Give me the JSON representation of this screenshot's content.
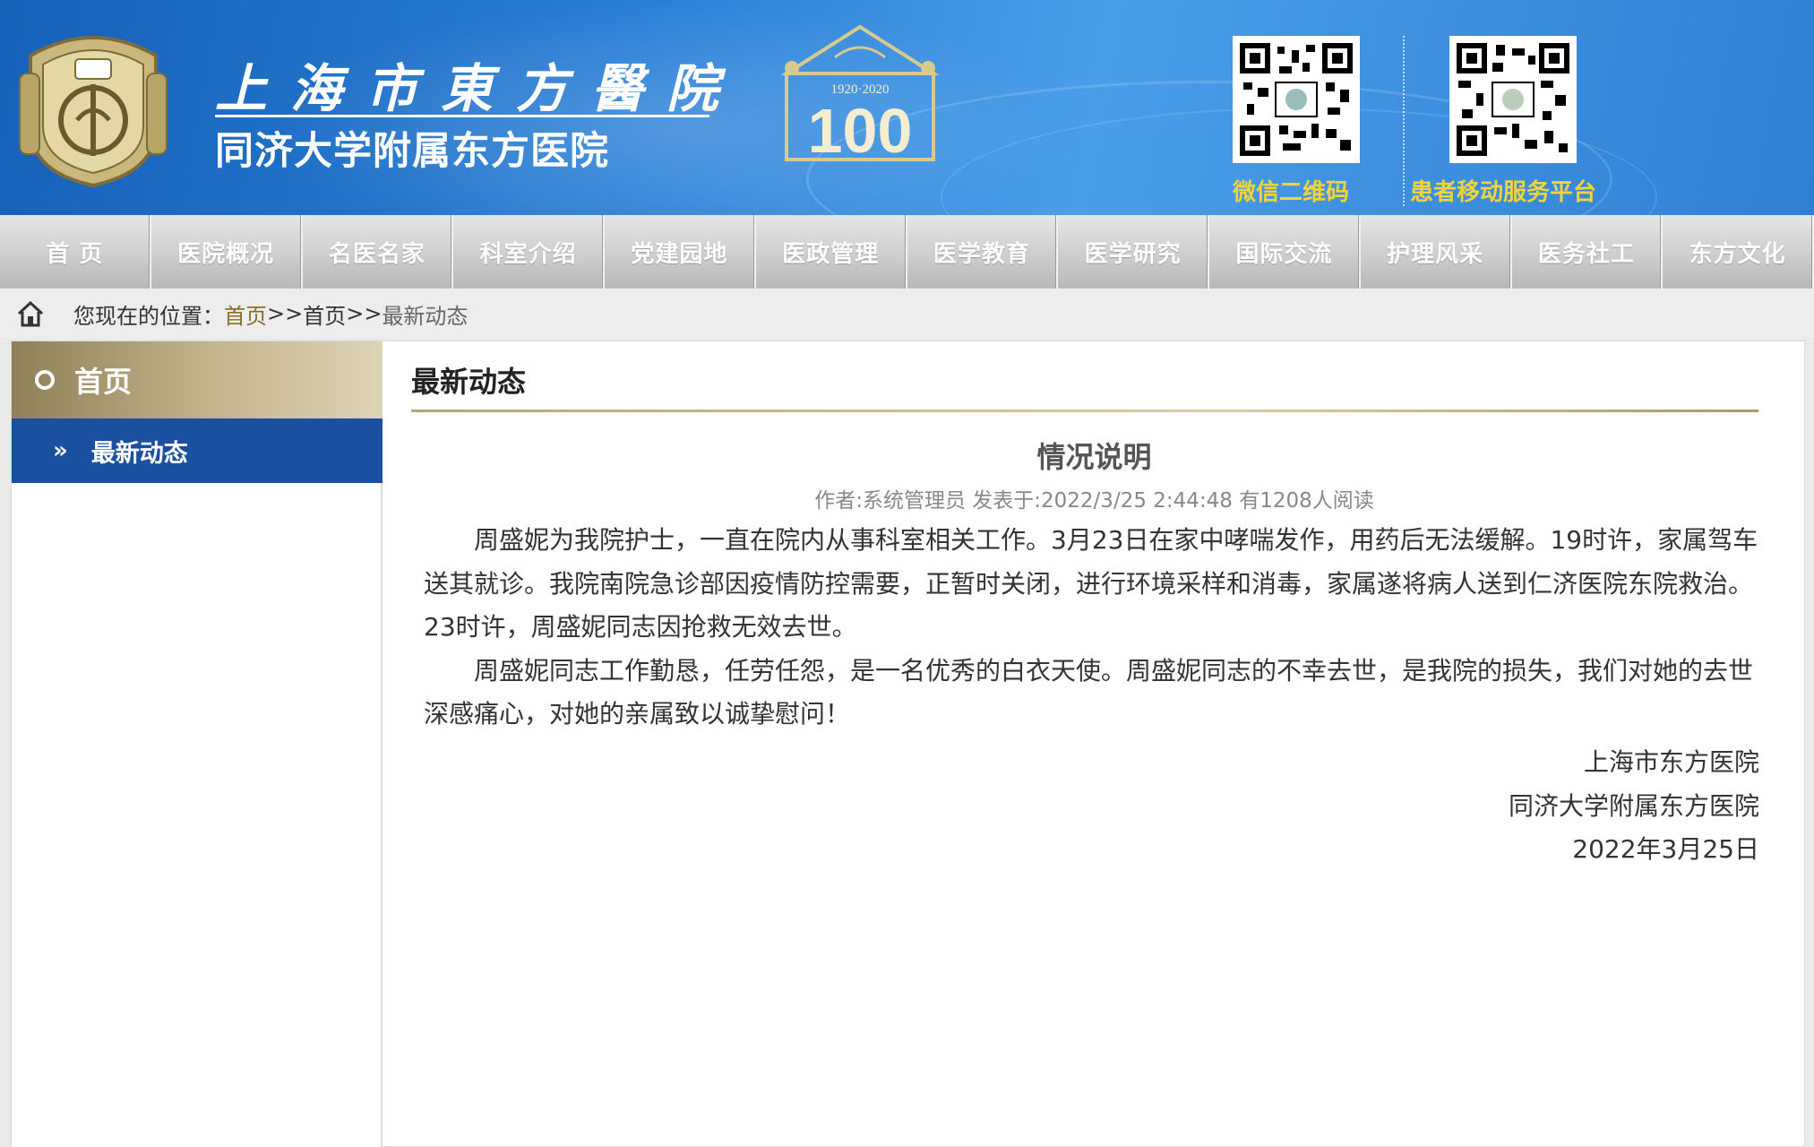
{
  "header": {
    "hospital_name": "上海市東方醫院",
    "hospital_name_sub": "同济大学附属东方医院",
    "centennial_years": "1920·2020",
    "centennial_number": "100",
    "qr_codes": [
      {
        "caption": "微信二维码"
      },
      {
        "caption": "患者移动服务平台"
      }
    ],
    "colors": {
      "header_blue": "#2a7fd6",
      "caption_yellow": "#f2d33a",
      "gold": "#c4b58c",
      "sidebar_blue": "#1b4fa0"
    }
  },
  "nav": {
    "items": [
      "首 页",
      "医院概况",
      "名医名家",
      "科室介绍",
      "党建园地",
      "医政管理",
      "医学教育",
      "医学研究",
      "国际交流",
      "护理风采",
      "医务社工",
      "东方文化"
    ]
  },
  "breadcrumb": {
    "label": "您现在的位置：",
    "link1": "首页",
    "sep1": " >>",
    "link2": "首页",
    "sep2": ">>",
    "current": "最新动态"
  },
  "sidebar": {
    "heading": "首页",
    "items": [
      {
        "label": "最新动态"
      }
    ]
  },
  "main": {
    "section_title": "最新动态",
    "article": {
      "title": "情况说明",
      "meta": "作者:系统管理员 发表于:2022/3/25 2:44:48 有1208人阅读",
      "paragraphs": [
        "周盛妮为我院护士，一直在院内从事科室相关工作。3月23日在家中哮喘发作，用药后无法缓解。19时许，家属驾车送其就诊。我院南院急诊部因疫情防控需要，正暂时关闭，进行环境采样和消毒，家属遂将病人送到仁济医院东院救治。23时许，周盛妮同志因抢救无效去世。",
        "周盛妮同志工作勤恳，任劳任怨，是一名优秀的白衣天使。周盛妮同志的不幸去世，是我院的损失，我们对她的去世深感痛心，对她的亲属致以诚挚慰问！"
      ],
      "signature": [
        "上海市东方医院",
        "同济大学附属东方医院",
        "2022年3月25日"
      ]
    }
  }
}
